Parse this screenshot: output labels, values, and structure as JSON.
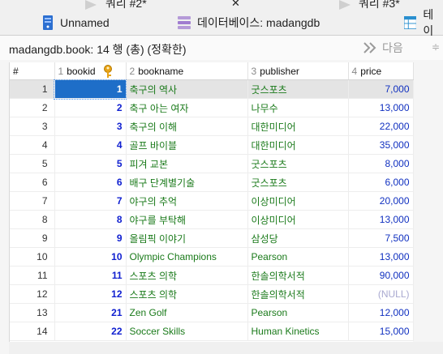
{
  "top_tabs": {
    "left_label": "쿼리 #2*",
    "close": "✕",
    "right_label": "쿼리 #3*"
  },
  "tabs": [
    {
      "label": "Unnamed",
      "icon": "server-icon"
    },
    {
      "label": "데이터베이스: madangdb",
      "icon": "database-icon"
    },
    {
      "label": "테이",
      "icon": "table-icon"
    }
  ],
  "toolbar": {
    "status": "madangdb.book: 14 행 (총) (정확한)",
    "next_label": "다음",
    "more": "≑"
  },
  "grid": {
    "columns": [
      {
        "num": "#",
        "name": ""
      },
      {
        "num": "1",
        "name": "bookid"
      },
      {
        "num": "2",
        "name": "bookname"
      },
      {
        "num": "3",
        "name": "publisher"
      },
      {
        "num": "4",
        "name": "price"
      }
    ],
    "rows": [
      {
        "row": "1",
        "bookid": "1",
        "bookname": "축구의 역사",
        "publisher": "굿스포츠",
        "price": "7,000"
      },
      {
        "row": "2",
        "bookid": "2",
        "bookname": "축구 아는 여자",
        "publisher": "나무수",
        "price": "13,000"
      },
      {
        "row": "3",
        "bookid": "3",
        "bookname": "축구의 이해",
        "publisher": "대한미디어",
        "price": "22,000"
      },
      {
        "row": "4",
        "bookid": "4",
        "bookname": "골프 바이블",
        "publisher": "대한미디어",
        "price": "35,000"
      },
      {
        "row": "5",
        "bookid": "5",
        "bookname": "피겨 교본",
        "publisher": "굿스포츠",
        "price": "8,000"
      },
      {
        "row": "6",
        "bookid": "6",
        "bookname": "배구 단계별기술",
        "publisher": "굿스포츠",
        "price": "6,000"
      },
      {
        "row": "7",
        "bookid": "7",
        "bookname": "야구의 추억",
        "publisher": "이상미디어",
        "price": "20,000"
      },
      {
        "row": "8",
        "bookid": "8",
        "bookname": "야구를 부탁해",
        "publisher": "이상미디어",
        "price": "13,000"
      },
      {
        "row": "9",
        "bookid": "9",
        "bookname": "올림픽 이야기",
        "publisher": "삼성당",
        "price": "7,500"
      },
      {
        "row": "10",
        "bookid": "10",
        "bookname": "Olympic Champions",
        "publisher": "Pearson",
        "price": "13,000"
      },
      {
        "row": "11",
        "bookid": "11",
        "bookname": "스포츠 의학",
        "publisher": "한솔의학서적",
        "price": "90,000"
      },
      {
        "row": "12",
        "bookid": "12",
        "bookname": "스포츠 의학",
        "publisher": "한솔의학서적",
        "price": "(NULL)"
      },
      {
        "row": "13",
        "bookid": "21",
        "bookname": "Zen Golf",
        "publisher": "Pearson",
        "price": "12,000"
      },
      {
        "row": "14",
        "bookid": "22",
        "bookname": "Soccer Skills",
        "publisher": "Human Kinetics",
        "price": "15,000"
      }
    ]
  },
  "colors": {
    "id_blue": "#1020d0",
    "text_green": "#1a7a1a",
    "selection": "#1e6ec8",
    "null_gray": "#a9a9d0"
  }
}
